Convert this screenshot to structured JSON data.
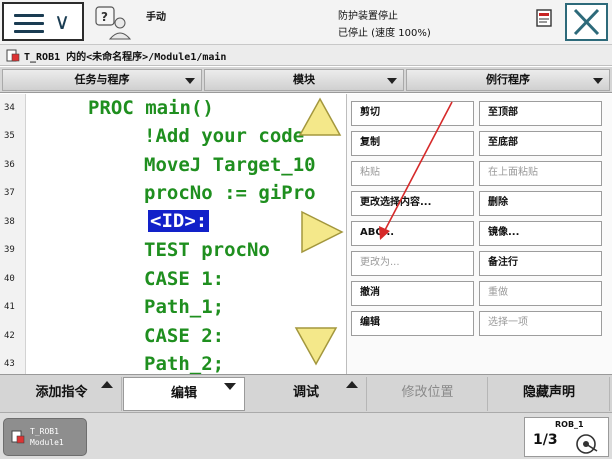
{
  "header": {
    "mode": "手动",
    "status_line1": "防护装置停止",
    "status_line2": "已停止 (速度 100%)"
  },
  "path": {
    "text": "T_ROB1 内的<未命名程序>/Module1/main"
  },
  "tabs": [
    {
      "label": "任务与程序"
    },
    {
      "label": "模块"
    },
    {
      "label": "例行程序"
    }
  ],
  "editor": {
    "lines": [
      {
        "num": "34",
        "text": "PROC main()"
      },
      {
        "num": "35",
        "text": "!Add your code"
      },
      {
        "num": "36",
        "text": "MoveJ Target_10"
      },
      {
        "num": "37",
        "text": "procNo := giPro"
      },
      {
        "num": "38",
        "text": "<ID>:"
      },
      {
        "num": "39",
        "text": "TEST procNo"
      },
      {
        "num": "40",
        "text": "CASE 1:"
      },
      {
        "num": "41",
        "text": "Path_1;"
      },
      {
        "num": "42",
        "text": "CASE 2:"
      },
      {
        "num": "43",
        "text": "Path_2;"
      }
    ],
    "selected_line": "38"
  },
  "edit_menu": {
    "buttons": [
      {
        "label": "剪切",
        "enabled": true
      },
      {
        "label": "至顶部",
        "enabled": true
      },
      {
        "label": "复制",
        "enabled": true
      },
      {
        "label": "至底部",
        "enabled": true
      },
      {
        "label": "粘贴",
        "enabled": false
      },
      {
        "label": "在上面粘贴",
        "enabled": false
      },
      {
        "label": "更改选择内容...",
        "enabled": true
      },
      {
        "label": "删除",
        "enabled": true
      },
      {
        "label": "ABC...",
        "enabled": true
      },
      {
        "label": "镜像...",
        "enabled": true
      },
      {
        "label": "更改为...",
        "enabled": false
      },
      {
        "label": "备注行",
        "enabled": true
      },
      {
        "label": "撤消",
        "enabled": true
      },
      {
        "label": "重做",
        "enabled": false
      },
      {
        "label": "编辑",
        "enabled": true
      },
      {
        "label": "选择一项",
        "enabled": false
      }
    ]
  },
  "command_bar": {
    "add_instruction": "添加指令",
    "edit": "编辑",
    "debug": "调试",
    "modify_position": "修改位置",
    "hide_declarations": "隐藏声明"
  },
  "taskbar": {
    "task_name": "T_ROB1",
    "task_module": "Module1",
    "robot_label": "ROB_1",
    "robot_fraction": "1/3"
  },
  "colors": {
    "code_text": "#1f8f1f",
    "selection_bg": "#1221c9",
    "scroll_arrow": "#f1e27c",
    "annotation_arrow": "#d62a2a"
  }
}
